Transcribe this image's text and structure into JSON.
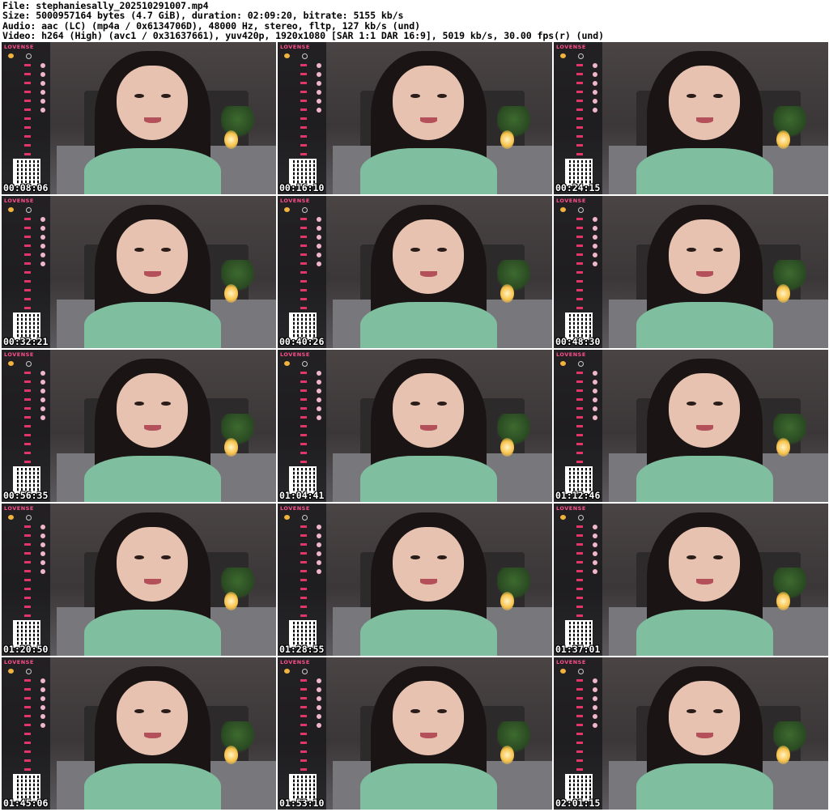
{
  "header": {
    "line1": "File: stephaniesally_202510291007.mp4",
    "line2": "Size: 5000957164 bytes (4.7 GiB), duration: 02:09:20, bitrate: 5155 kb/s",
    "line3": "Audio: aac (LC) (mp4a / 0x6134706D), 48000 Hz, stereo, fltp, 127 kb/s (und)",
    "line4": "Video: h264 (High) (avc1 / 0x31637661), yuv420p, 1920x1080 [SAR 1:1 DAR 16:9], 5019 kb/s, 30.00 fps(r) (und)"
  },
  "overlay": {
    "brand": "LOVENSE"
  },
  "thumbnails": [
    {
      "timestamp": "00:08:06"
    },
    {
      "timestamp": "00:16:10"
    },
    {
      "timestamp": "00:24:15"
    },
    {
      "timestamp": "00:32:21"
    },
    {
      "timestamp": "00:40:26"
    },
    {
      "timestamp": "00:48:30"
    },
    {
      "timestamp": "00:56:35"
    },
    {
      "timestamp": "01:04:41"
    },
    {
      "timestamp": "01:12:46"
    },
    {
      "timestamp": "01:20:50"
    },
    {
      "timestamp": "01:28:55"
    },
    {
      "timestamp": "01:37:01"
    },
    {
      "timestamp": "01:45:06"
    },
    {
      "timestamp": "01:53:10"
    },
    {
      "timestamp": "02:01:15"
    }
  ]
}
